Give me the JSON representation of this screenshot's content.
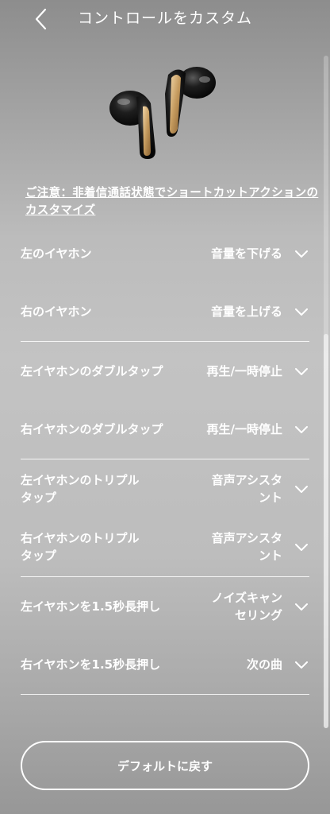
{
  "header": {
    "title": "コントロールをカスタム"
  },
  "notice": "ご注意：非着信通話状態でショートカットアクションのカスタマイズ",
  "settings": [
    {
      "label": "左のイヤホン",
      "value": "音量を下げる"
    },
    {
      "label": "右のイヤホン",
      "value": "音量を上げる"
    },
    {
      "label": "左イヤホンのダブルタップ",
      "value": "再生/一時停止"
    },
    {
      "label": "右イヤホンのダブルタップ",
      "value": "再生/一時停止"
    },
    {
      "label": "左イヤホンのトリプル\nタップ",
      "value": "音声アシスタ\nント"
    },
    {
      "label": "右イヤホンのトリプル\nタップ",
      "value": "音声アシスタ\nント"
    },
    {
      "label": "左イヤホンを1.5秒長押し",
      "value": "ノイズキャン\nセリング"
    },
    {
      "label": "右イヤホンを1.5秒長押し",
      "value": "次の曲"
    }
  ],
  "reset_button": "デフォルトに戻す",
  "icons": {
    "back": "chevron-left-icon",
    "expand": "chevron-down-icon"
  },
  "colors": {
    "text": "#ffffff",
    "earbud_body": "#1a1a1a",
    "earbud_accent": "#c49a5e"
  }
}
